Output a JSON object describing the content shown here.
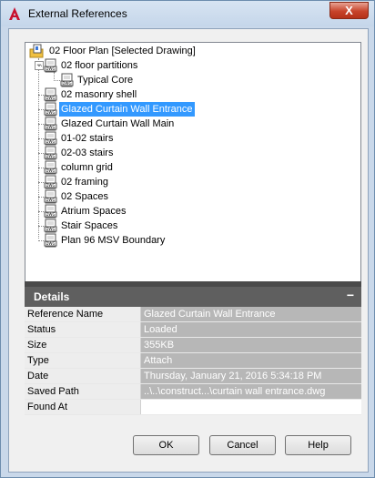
{
  "window": {
    "title": "External References",
    "close_label": "X"
  },
  "tree": {
    "root": {
      "label": "02 Floor Plan [Selected Drawing]"
    },
    "items": [
      {
        "label": "02 floor partitions"
      },
      {
        "label": "Typical Core"
      },
      {
        "label": "02 masonry shell"
      },
      {
        "label": "Glazed Curtain Wall Entrance",
        "selected": true
      },
      {
        "label": "Glazed Curtain Wall Main"
      },
      {
        "label": "01-02 stairs"
      },
      {
        "label": "02-03 stairs"
      },
      {
        "label": "column grid"
      },
      {
        "label": "02 framing"
      },
      {
        "label": "02 Spaces"
      },
      {
        "label": "Atrium Spaces"
      },
      {
        "label": "Stair Spaces"
      },
      {
        "label": "Plan 96 MSV Boundary"
      }
    ],
    "expander_symbol": "−"
  },
  "details": {
    "title": "Details",
    "collapse_symbol": "−",
    "rows": [
      {
        "key": "Reference Name",
        "value": "Glazed Curtain Wall Entrance"
      },
      {
        "key": "Status",
        "value": "Loaded"
      },
      {
        "key": "Size",
        "value": "355KB"
      },
      {
        "key": "Type",
        "value": "Attach"
      },
      {
        "key": "Date",
        "value": "Thursday, January 21, 2016  5:34:18 PM"
      },
      {
        "key": "Saved Path",
        "value": "..\\..\\construct...\\curtain wall entrance.dwg"
      },
      {
        "key": "Found At",
        "value": ""
      }
    ]
  },
  "buttons": {
    "ok": "OK",
    "cancel": "Cancel",
    "help": "Help"
  },
  "icons": {
    "app": "autocad-a-icon",
    "root": "folder-drawing-icon",
    "item": "dwg-file-icon"
  },
  "colors": {
    "selection": "#3399ff",
    "details_header": "#5f5f5f",
    "title_bar": "#c9d8ea"
  }
}
